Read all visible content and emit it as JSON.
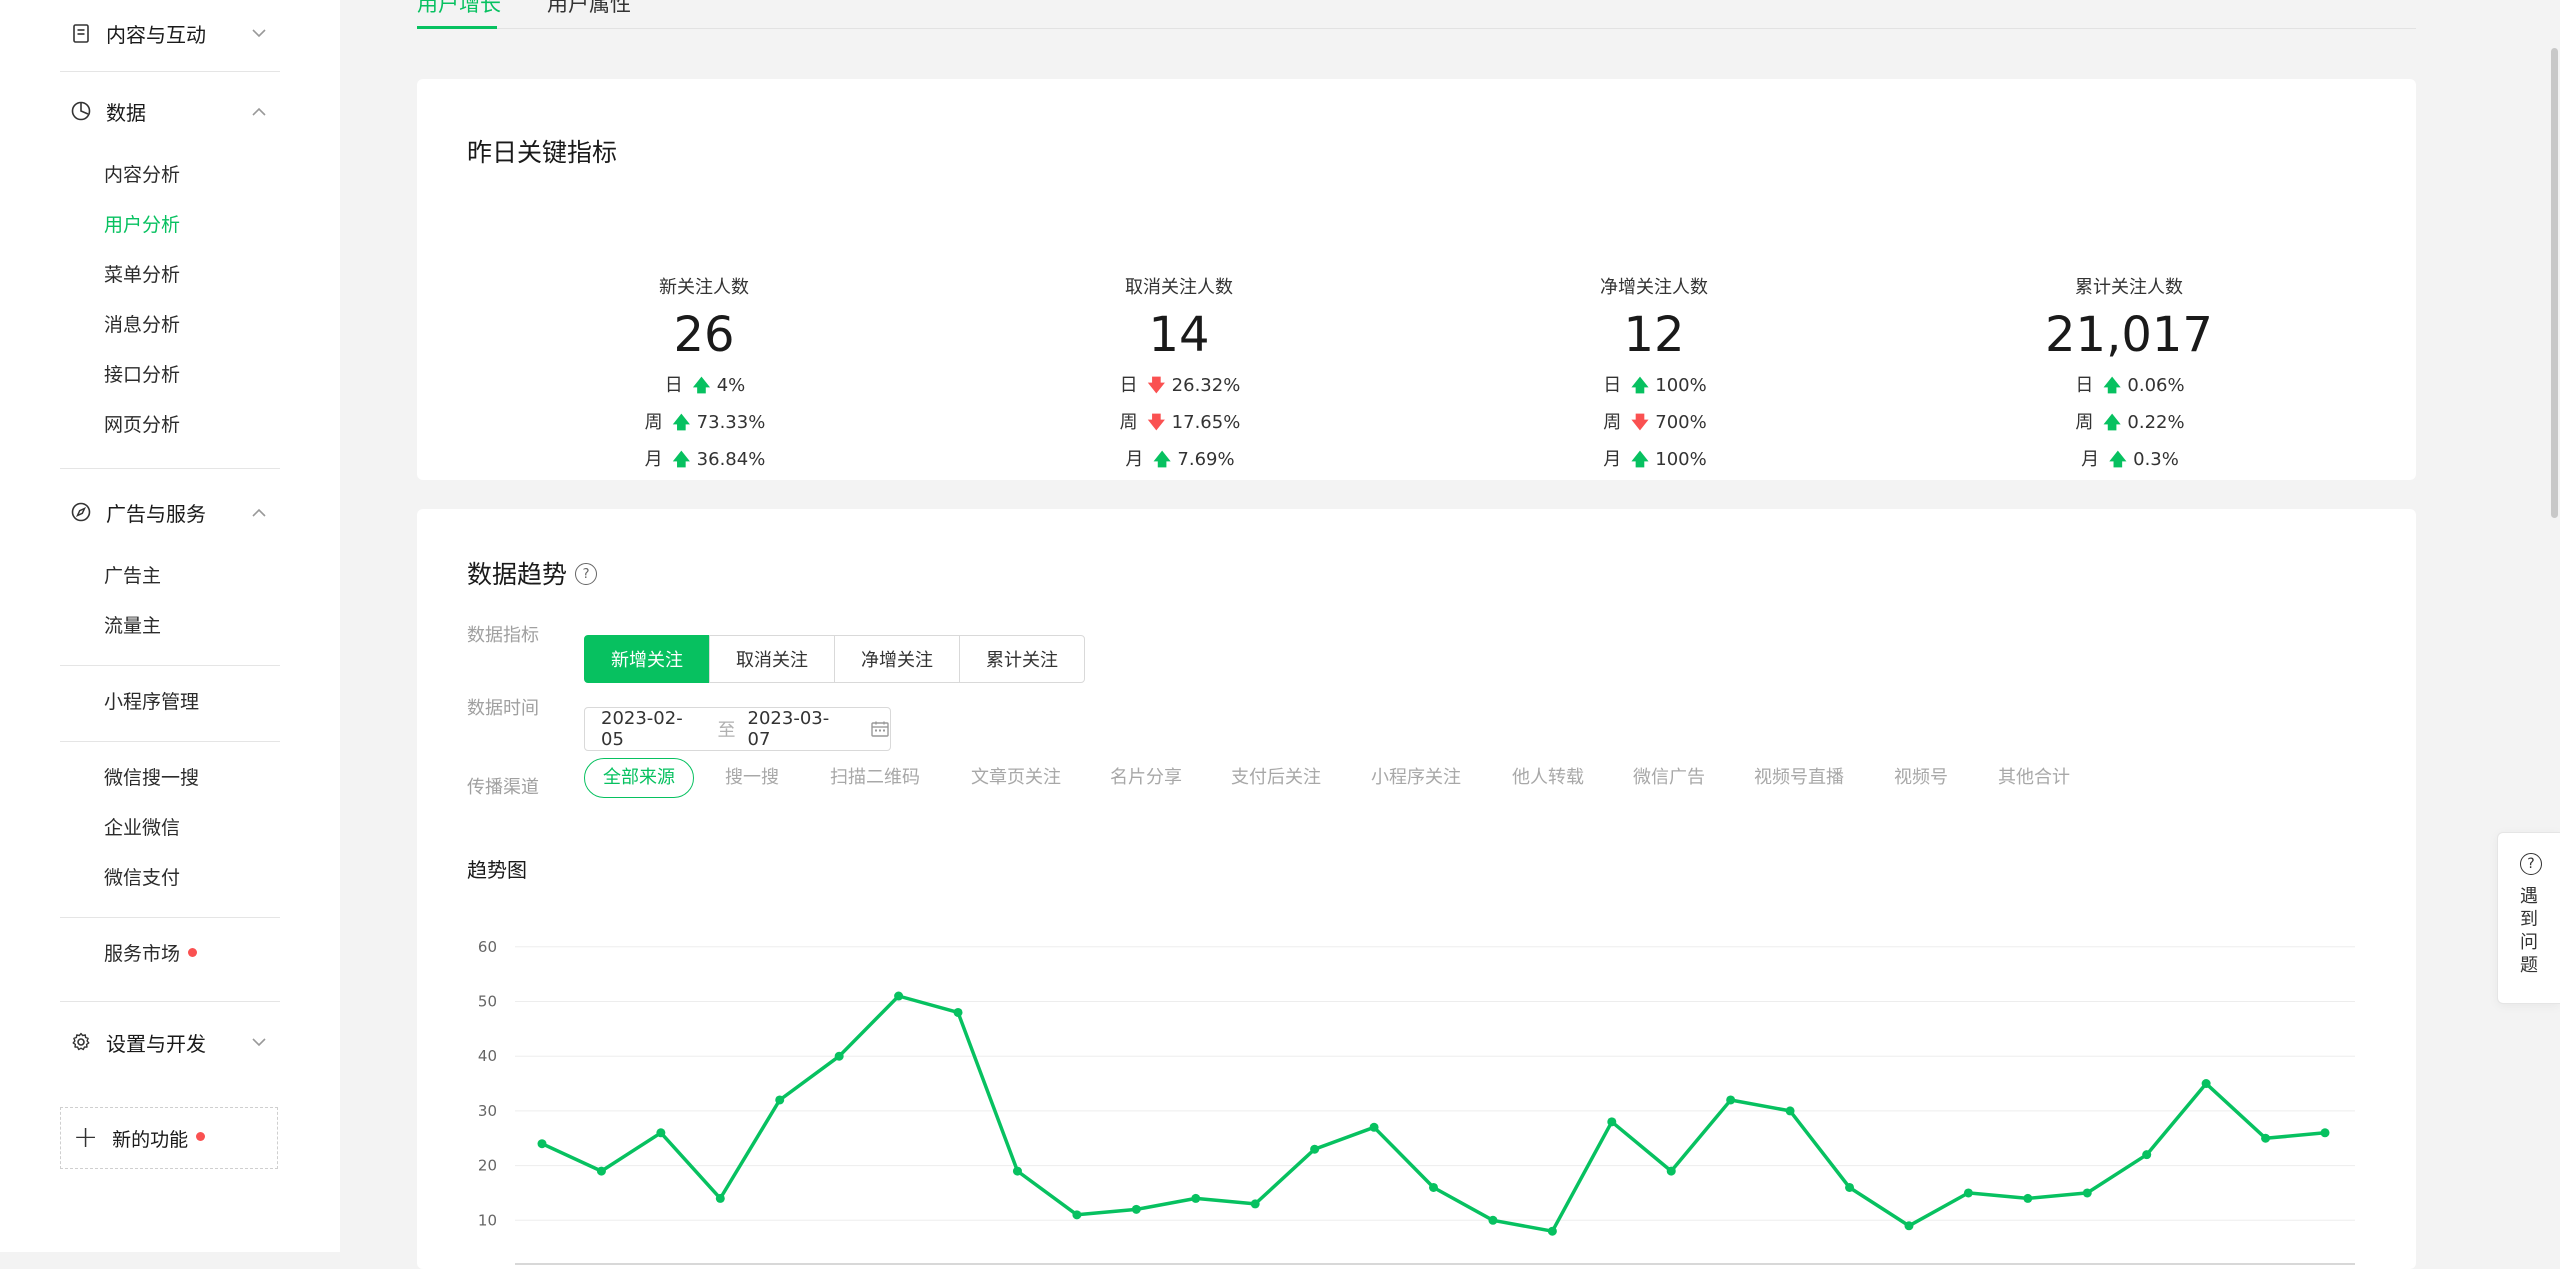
{
  "sidebar": {
    "content_group": "内容与互动",
    "data_group": "数据",
    "data_items": [
      "内容分析",
      "用户分析",
      "菜单分析",
      "消息分析",
      "接口分析",
      "网页分析"
    ],
    "ads_group": "广告与服务",
    "ads_items": [
      "广告主",
      "流量主"
    ],
    "mini_program": "小程序管理",
    "wechat_items": [
      "微信搜一搜",
      "企业微信",
      "微信支付"
    ],
    "service_market": "服务市场",
    "settings_group": "设置与开发",
    "new_features": "新的功能",
    "accent_color": "#07c160",
    "dot_color": "#fa5151"
  },
  "tabs": [
    "用户增长",
    "用户属性"
  ],
  "metrics": {
    "title": "昨日关键指标",
    "row_labels": [
      "日",
      "周",
      "月"
    ],
    "items": [
      {
        "label": "新关注人数",
        "value": "26",
        "rows": [
          {
            "dir": "up",
            "pct": "4%"
          },
          {
            "dir": "up",
            "pct": "73.33%"
          },
          {
            "dir": "up",
            "pct": "36.84%"
          }
        ]
      },
      {
        "label": "取消关注人数",
        "value": "14",
        "rows": [
          {
            "dir": "down",
            "pct": "26.32%"
          },
          {
            "dir": "down",
            "pct": "17.65%"
          },
          {
            "dir": "up",
            "pct": "7.69%"
          }
        ]
      },
      {
        "label": "净增关注人数",
        "value": "12",
        "rows": [
          {
            "dir": "up",
            "pct": "100%"
          },
          {
            "dir": "down",
            "pct": "700%"
          },
          {
            "dir": "up",
            "pct": "100%"
          }
        ]
      },
      {
        "label": "累计关注人数",
        "value": "21,017",
        "rows": [
          {
            "dir": "up",
            "pct": "0.06%"
          },
          {
            "dir": "up",
            "pct": "0.22%"
          },
          {
            "dir": "up",
            "pct": "0.3%"
          }
        ]
      }
    ]
  },
  "trend": {
    "title": "数据趋势",
    "metric_label": "数据指标",
    "metric_options": [
      "新增关注",
      "取消关注",
      "净增关注",
      "累计关注"
    ],
    "time_label": "数据时间",
    "date_start": "2023-02-05",
    "date_sep": "至",
    "date_end": "2023-03-07",
    "channel_label": "传播渠道",
    "channels": [
      "全部来源",
      "搜一搜",
      "扫描二维码",
      "文章页关注",
      "名片分享",
      "支付后关注",
      "小程序关注",
      "他人转载",
      "微信广告",
      "视频号直播",
      "视频号",
      "其他合计"
    ],
    "chart_title": "趋势图"
  },
  "chart_data": {
    "type": "line",
    "title": "趋势图",
    "y_ticks": [
      10,
      20,
      30,
      40,
      50,
      60
    ],
    "ylim": [
      0,
      60
    ],
    "grid": true,
    "legend": "none",
    "line_color": "#07c160",
    "series": [
      {
        "values": [
          24,
          19,
          26,
          14,
          32,
          40,
          51,
          48,
          19,
          11,
          12,
          14,
          13,
          23,
          27,
          16,
          10,
          8,
          28,
          19,
          32,
          30,
          16,
          9,
          15,
          14,
          15,
          22,
          35,
          25,
          26
        ]
      }
    ]
  },
  "help_float": [
    "遇",
    "到",
    "问",
    "题"
  ]
}
